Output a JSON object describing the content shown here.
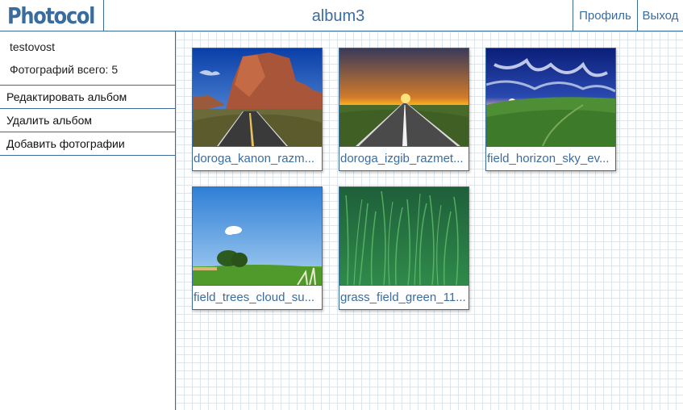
{
  "header": {
    "logo": "Photocol",
    "album_title": "album3",
    "nav": {
      "profile": "Профиль",
      "exit": "Выход"
    }
  },
  "sidebar": {
    "username": "testovost",
    "photo_count": "Фотографий всего: 5",
    "menu": [
      {
        "label": "Редактировать альбом"
      },
      {
        "label": "Удалить альбом"
      },
      {
        "label": "Добавить фотографии"
      }
    ]
  },
  "photos": [
    {
      "caption": "doroga_kanon_razm...",
      "thumb": "canyon-road-image"
    },
    {
      "caption": "doroga_izgib_razmet...",
      "thumb": "sunset-road-image"
    },
    {
      "caption": "field_horizon_sky_ev...",
      "thumb": "field-sky-image"
    },
    {
      "caption": "field_trees_cloud_su...",
      "thumb": "trees-field-image"
    },
    {
      "caption": "grass_field_green_11...",
      "thumb": "green-grass-image"
    }
  ],
  "colors": {
    "accent": "#3a6d9e",
    "grid": "#dbe6ef"
  }
}
